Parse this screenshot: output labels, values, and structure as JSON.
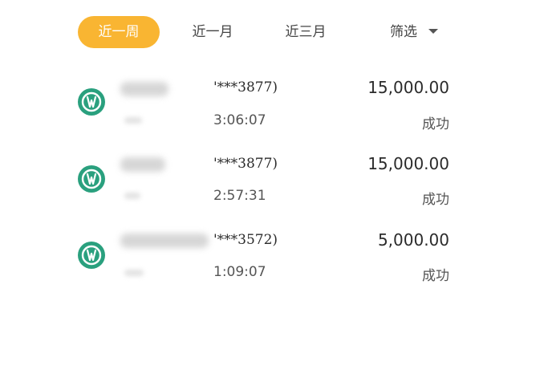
{
  "filter_tabs": [
    {
      "label": "近一周",
      "active": true
    },
    {
      "label": "近一月",
      "active": false
    },
    {
      "label": "近三月",
      "active": false
    }
  ],
  "filter_dropdown": {
    "label": "筛选"
  },
  "transactions": [
    {
      "account": "'***3877)",
      "time": "3:06:07",
      "amount": "15,000.00",
      "status": "成功"
    },
    {
      "account": "'***3877)",
      "time": "2:57:31",
      "amount": "15,000.00",
      "status": "成功"
    },
    {
      "account": "'***3572)",
      "time": "1:09:07",
      "amount": "5,000.00",
      "status": "成功"
    }
  ],
  "colors": {
    "accent": "#f9b532",
    "icon_bg": "#2aa07e",
    "text": "#333333"
  },
  "icon": "bank-logo-icon"
}
